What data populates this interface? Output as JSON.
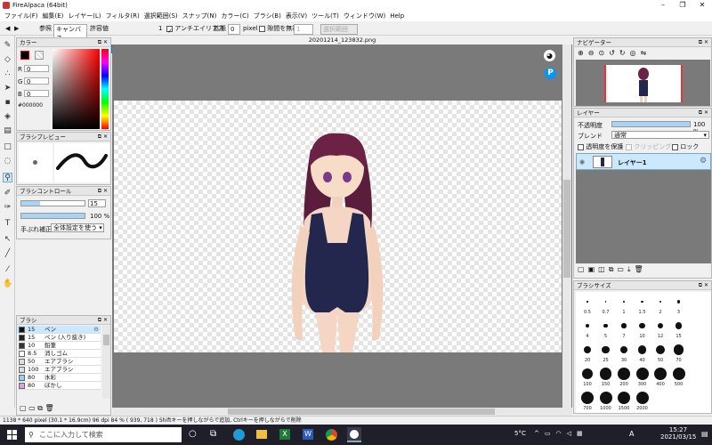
{
  "window": {
    "title": "FireAlpaca (64bit)"
  },
  "menu": [
    "ファイル(F)",
    "編集(E)",
    "レイヤー(L)",
    "フィルタ(R)",
    "選択範囲(S)",
    "スナップ(N)",
    "カラー(C)",
    "ブラシ(B)",
    "表示(V)",
    "ツール(T)",
    "ウィンドウ(W)",
    "Help"
  ],
  "toolbar": {
    "ref_label": "参照",
    "ref_value": "キャンバス",
    "tolerance_label": "許容値",
    "tolerance_value": "1",
    "antialias_label": "アンチエイリアス",
    "expand_label": "拡張",
    "expand_value": "0",
    "expand_unit": "pixel",
    "gap_label": "隙間を無視",
    "gap_value": "1",
    "fill_label": "選択範囲"
  },
  "document": {
    "tab": "20201214_123832.png"
  },
  "color_panel": {
    "title": "カラー",
    "r_label": "R",
    "r_value": "0",
    "g_label": "G",
    "g_value": "0",
    "b_label": "B",
    "b_value": "0",
    "hex": "#000000"
  },
  "brush_preview": {
    "title": "ブラシプレビュー"
  },
  "brush_control": {
    "title": "ブラシコントロール",
    "size_value": "15",
    "opacity_value": "100 %",
    "stabilizer_label": "手ぶれ補正",
    "stabilizer_value": "全体設定を使う",
    "opacity_fraction": 1.0,
    "size_fraction": 0.3
  },
  "brush_panel": {
    "title": "ブラシ",
    "items": [
      {
        "size": "15",
        "name": "ペン",
        "color": "#111111"
      },
      {
        "size": "15",
        "name": "ペン (入り抜き)",
        "color": "#222222"
      },
      {
        "size": "10",
        "name": "鉛筆",
        "color": "#333333"
      },
      {
        "size": "8.5",
        "name": "消しゴム",
        "color": "#ffffff"
      },
      {
        "size": "50",
        "name": "エアブラシ",
        "color": "#dddddd"
      },
      {
        "size": "100",
        "name": "エアブラシ",
        "color": "#dddddd"
      },
      {
        "size": "80",
        "name": "水彩",
        "color": "#8fd3ff"
      },
      {
        "size": "80",
        "name": "ぼかし",
        "color": "#e0a0e0"
      }
    ]
  },
  "navigator": {
    "title": "ナビゲーター"
  },
  "layer_panel": {
    "title": "レイヤー",
    "opacity_label": "不透明度",
    "opacity_value": "100 %",
    "opacity_fraction": 1.0,
    "blend_label": "ブレンド",
    "blend_value": "通常",
    "protect_label": "透明度を保護",
    "clipping_label": "クリッピング",
    "lock_label": "ロック",
    "layer_name": "レイヤー1"
  },
  "brush_size_panel": {
    "title": "ブラシサイズ",
    "sizes": [
      "0.5",
      "0.7",
      "1",
      "1.5",
      "2",
      "3",
      "4",
      "5",
      "7",
      "10",
      "12",
      "15",
      "20",
      "25",
      "30",
      "40",
      "50",
      "70",
      "100",
      "150",
      "200",
      "300",
      "400",
      "500",
      "700",
      "1000",
      "1500",
      "2000"
    ]
  },
  "status": {
    "text": "1138 * 640 pixel  (30.1 * 16.9cm)  96 dpi  84 %  ( 939, 718 )  Shiftキーを押しながらで追加, Ctrlキーを押しながらで削除"
  },
  "taskbar": {
    "search_placeholder": "ここに入力して検索",
    "time": "15:27",
    "date": "2021/03/15",
    "weather": "5°C",
    "ime": "A"
  }
}
